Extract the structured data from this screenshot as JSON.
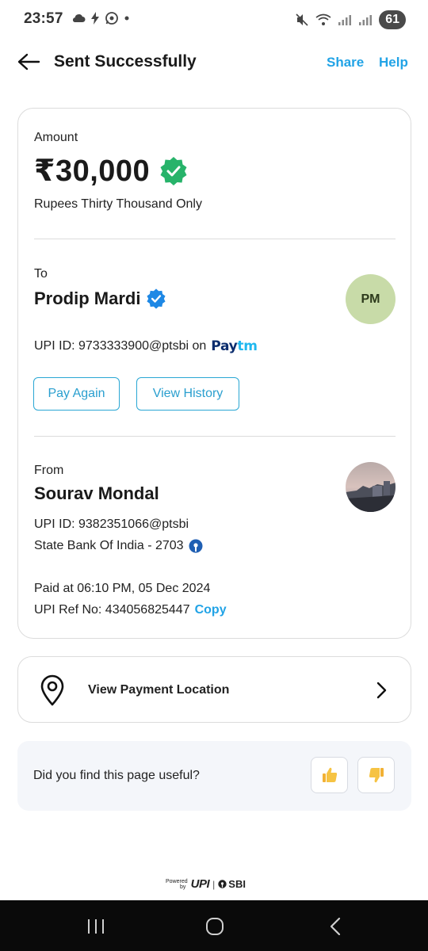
{
  "status_bar": {
    "time": "23:57",
    "battery": "61"
  },
  "header": {
    "title": "Sent Successfully",
    "share_label": "Share",
    "help_label": "Help"
  },
  "amount": {
    "label": "Amount",
    "value": "₹30,000",
    "words": "Rupees Thirty Thousand Only"
  },
  "recipient": {
    "label": "To",
    "name": "Prodip Mardi",
    "initials": "PM",
    "upi_id": "UPI ID: 9733333900@ptsbi on",
    "app_logo_pay": "Pay",
    "app_logo_tm": "tm",
    "pay_again_label": "Pay Again",
    "view_history_label": "View History"
  },
  "sender": {
    "label": "From",
    "name": "Sourav Mondal",
    "upi_id": "UPI ID: 9382351066@ptsbi",
    "bank": "State Bank Of India - 2703"
  },
  "transaction": {
    "paid_at": "Paid at 06:10 PM, 05 Dec 2024",
    "ref_no": "UPI Ref No: 434056825447",
    "copy_label": "Copy"
  },
  "location": {
    "label": "View Payment Location"
  },
  "feedback": {
    "question": "Did you find this page useful?"
  },
  "footer": {
    "powered_line1": "Powered",
    "powered_line2": "by",
    "upi_logo": "UPI",
    "sbi_logo": "SBI"
  },
  "colors": {
    "accent": "#21a3e6",
    "verified_green": "#27b36a",
    "verified_blue": "#1e88e5",
    "avatar_bg": "#c8dba8"
  }
}
